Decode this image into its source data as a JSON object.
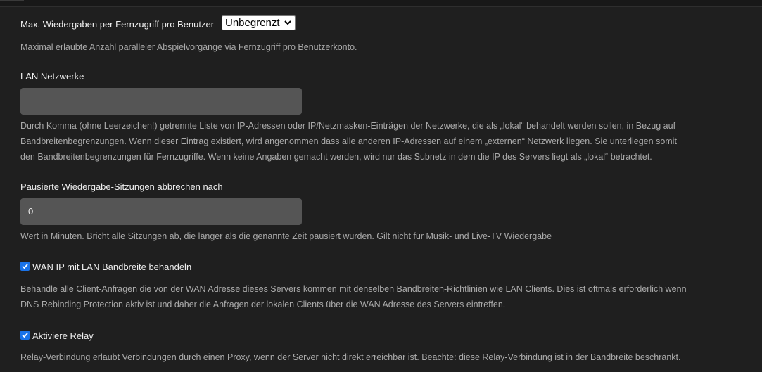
{
  "max_streams": {
    "label": "Max. Wiedergaben per Fernzugriff pro Benutzer",
    "selected": "Unbegrenzt",
    "help": "Maximal erlaubte Anzahl paralleler Abspielvorgänge via Fernzugriff pro Benutzerkonto."
  },
  "lan_networks": {
    "label": "LAN Netzwerke",
    "value": "",
    "help_lines": [
      "Durch Komma (ohne Leerzeichen!) getrennte Liste von IP-Adressen oder IP/Netzmasken-Einträgen der Netzwerke, die als „lokal“ behandelt werden sollen, in Bezug auf",
      "Bandbreitenbegrenzungen. Wenn dieser Eintrag existiert, wird angenommen dass alle anderen IP-Adressen auf einem „externen“ Netzwerk liegen. Sie unterliegen somit",
      "den Bandbreitenbegrenzungen für Fernzugriffe. Wenn keine Angaben gemacht werden, wird nur das Subnetz in dem die IP des Servers liegt als „lokal“ betrachtet."
    ]
  },
  "paused_sessions": {
    "label": "Pausierte Wiedergabe-Sitzungen abbrechen nach",
    "value": "0",
    "help": "Wert in Minuten. Bricht alle Sitzungen ab, die länger als die genannte Zeit pausiert wurden. Gilt nicht für Musik- und Live-TV Wiedergabe"
  },
  "wan_ip": {
    "label": "WAN IP mit LAN Bandbreite behandeln",
    "checked": true,
    "help_lines": [
      "Behandle alle Client-Anfragen die von der WAN Adresse dieses Servers kommen mit denselben Bandbreiten-Richtlinien wie LAN Clients. Dies ist oftmals erforderlich wenn",
      "DNS Rebinding Protection aktiv ist und daher die Anfragen der lokalen Clients über die WAN Adresse des Servers eintreffen."
    ]
  },
  "relay": {
    "label": "Aktiviere Relay",
    "checked": true,
    "help": "Relay-Verbindung erlaubt Verbindungen durch einen Proxy, wenn der Server nicht direkt erreichbar ist. Beachte: diese Relay-Verbindung ist in der Bandbreite beschränkt."
  },
  "colors": {
    "background": "#1f1f1f",
    "input_background": "#555555",
    "checkbox_accent": "#1a73e8",
    "label_text": "#eeeeee",
    "help_text": "#aaaaaa"
  },
  "icons": {
    "select_arrow": "chevron-down-icon",
    "checkbox_mark": "check-icon"
  }
}
